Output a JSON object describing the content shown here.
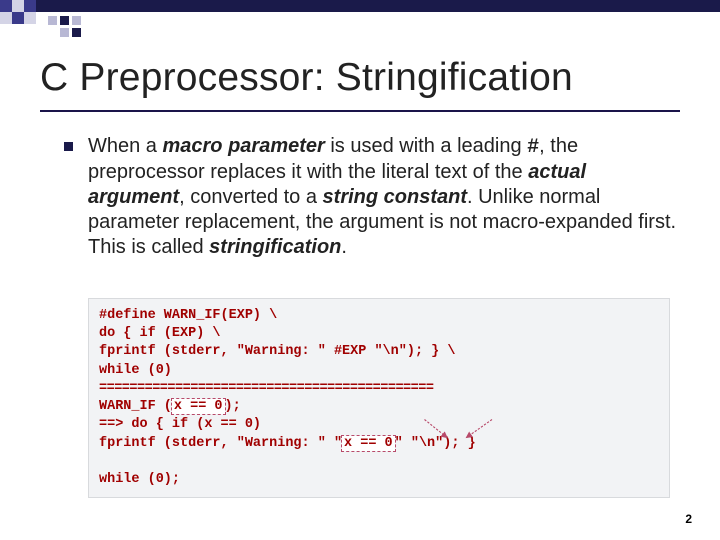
{
  "title": "C Preprocessor: Stringification",
  "bullet": {
    "t1": "When a ",
    "bi1": "macro parameter",
    "t2": " is used with a leading ",
    "hash": "#",
    "t3": ", the preprocessor replaces it with the literal text of the ",
    "bi2": "actual argument",
    "t4": ", converted to a ",
    "bi3": "string constant",
    "t5": ". Unlike normal parameter replacement, the argument is not macro-expanded first. This is called ",
    "bi4": "stringification",
    "t6": "."
  },
  "code": {
    "l1": "#define WARN_IF(EXP) \\",
    "l2": "do { if (EXP) \\",
    "l3": "fprintf (stderr, \"Warning: \" #EXP \"\\n\"); } \\",
    "l4": "while (0)",
    "sep": "============================================",
    "l5a": "WARN_IF (",
    "l5hl": "x == 0",
    "l5b": ");",
    "l6": "==> do { if (x == 0)",
    "l7a": "fprintf (stderr, \"Warning: \" \"",
    "l7hl": "x == 0",
    "l7b": "\" \"\\n\"); }",
    "blank": "",
    "l8": "while (0);"
  },
  "page": "2"
}
